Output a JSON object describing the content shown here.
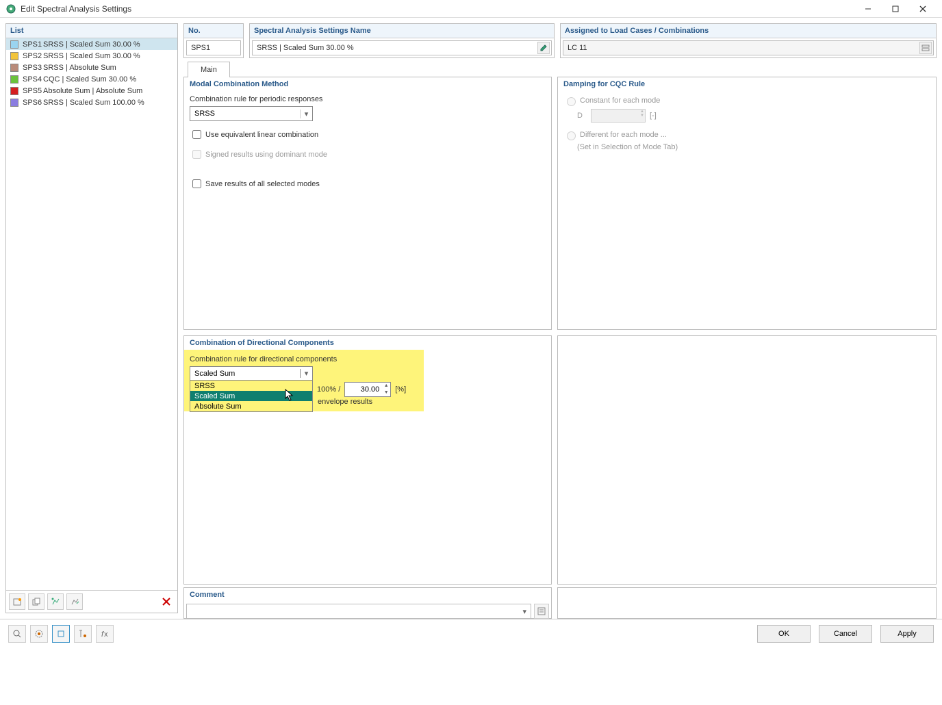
{
  "window": {
    "title": "Edit Spectral Analysis Settings"
  },
  "list": {
    "header": "List",
    "items": [
      {
        "color": "#9ad4f0",
        "id": "SPS1",
        "name": "SRSS | Scaled Sum 30.00 %",
        "selected": true
      },
      {
        "color": "#f2c43b",
        "id": "SPS2",
        "name": "SRSS | Scaled Sum 30.00 %",
        "selected": false
      },
      {
        "color": "#b98b7a",
        "id": "SPS3",
        "name": "SRSS | Absolute Sum",
        "selected": false
      },
      {
        "color": "#6bc23c",
        "id": "SPS4",
        "name": "CQC | Scaled Sum 30.00 %",
        "selected": false
      },
      {
        "color": "#d41f1f",
        "id": "SPS5",
        "name": "Absolute Sum | Absolute Sum",
        "selected": false
      },
      {
        "color": "#8a7de0",
        "id": "SPS6",
        "name": "SRSS | Scaled Sum 100.00 %",
        "selected": false
      }
    ]
  },
  "top": {
    "no_header": "No.",
    "no_value": "SPS1",
    "name_header": "Spectral Analysis Settings Name",
    "name_value": "SRSS | Scaled Sum 30.00 %",
    "assigned_header": "Assigned to Load Cases / Combinations",
    "assigned_value": "LC 11"
  },
  "tabs": {
    "main": "Main"
  },
  "modal": {
    "header": "Modal Combination Method",
    "rule_label": "Combination rule for periodic responses",
    "rule_value": "SRSS",
    "cb_equiv": "Use equivalent linear combination",
    "cb_signed": "Signed results using dominant mode",
    "cb_save": "Save results of all selected modes"
  },
  "damping": {
    "header": "Damping for CQC Rule",
    "r_constant": "Constant for each mode",
    "d_label": "D",
    "d_unit": "[-]",
    "r_diff": "Different for each mode ...",
    "r_diff_note": "(Set in Selection of Mode Tab)"
  },
  "directional": {
    "header": "Combination of Directional Components",
    "label": "Combination rule for directional components",
    "selected": "Scaled Sum",
    "options": [
      "SRSS",
      "Scaled Sum",
      "Absolute Sum"
    ],
    "pct_label": "100% /",
    "pct_value": "30.00",
    "pct_unit": "[%]",
    "env_text": "envelope results"
  },
  "comment": {
    "header": "Comment"
  },
  "footer": {
    "ok": "OK",
    "cancel": "Cancel",
    "apply": "Apply"
  }
}
